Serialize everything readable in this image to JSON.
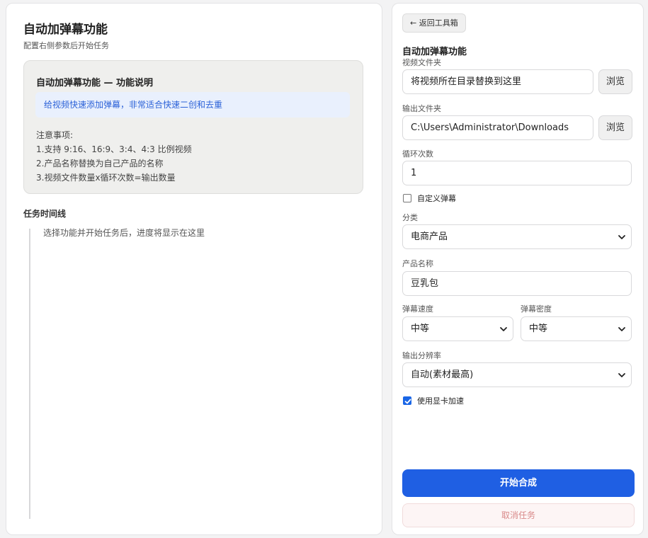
{
  "left": {
    "title": "自动加弹幕功能",
    "subtitle": "配置右侧参数后开始任务",
    "info": {
      "title": "自动加弹幕功能 — 功能说明",
      "highlight": "给视频快速添加弹幕，非常适合快速二创和去重",
      "notes_title": "注意事项:",
      "notes": [
        "1.支持 9:16、16:9、3:4、4:3 比例视频",
        "2.产品名称替换为自己产品的名称",
        "3.视频文件数量x循环次数=输出数量"
      ]
    },
    "timeline": {
      "title": "任务时间线",
      "empty_text": "选择功能并开始任务后，进度将显示在这里"
    }
  },
  "right": {
    "back_label": "← 返回工具箱",
    "tool_title": "自动加弹幕功能",
    "video_folder": {
      "label": "视频文件夹",
      "value": "将视频所在目录替换到这里",
      "browse": "浏览"
    },
    "output_folder": {
      "label": "输出文件夹",
      "value": "C:\\Users\\Administrator\\Downloads",
      "browse": "浏览"
    },
    "loop_count": {
      "label": "循环次数",
      "value": "1"
    },
    "custom_danmaku": {
      "label": "自定义弹幕",
      "checked": false
    },
    "category": {
      "label": "分类",
      "value": "电商产品"
    },
    "product_name": {
      "label": "产品名称",
      "value": "豆乳包"
    },
    "speed": {
      "label": "弹幕速度",
      "value": "中等"
    },
    "density": {
      "label": "弹幕密度",
      "value": "中等"
    },
    "resolution": {
      "label": "输出分辨率",
      "value": "自动(素材最高)"
    },
    "gpu": {
      "label": "使用显卡加速",
      "checked": true
    },
    "start_label": "开始合成",
    "cancel_label": "取消任务"
  },
  "colors": {
    "accent": "#1f5fe3",
    "highlight_text": "#2c62d8",
    "cancel_text": "#d98a8a"
  }
}
